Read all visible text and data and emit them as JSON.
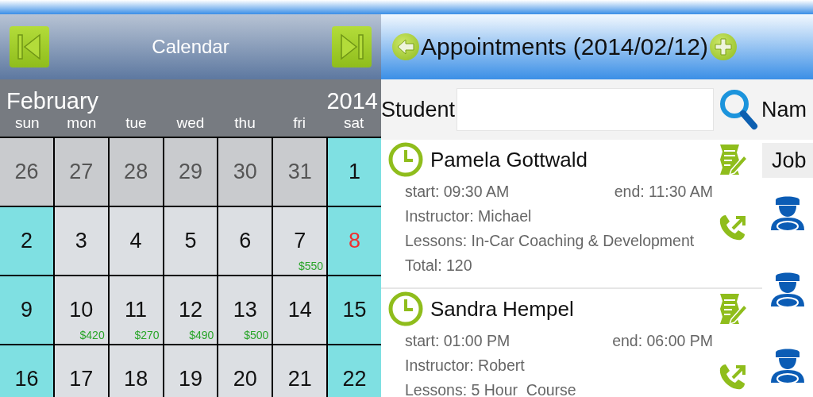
{
  "calendar": {
    "title": "Calendar",
    "month": "February",
    "year": "2014",
    "weekdays": [
      "sun",
      "mon",
      "tue",
      "wed",
      "thu",
      "fri",
      "sat"
    ],
    "weeks": [
      [
        {
          "day": "26",
          "kind": "other",
          "marked": false
        },
        {
          "day": "27",
          "kind": "other",
          "marked": false
        },
        {
          "day": "28",
          "kind": "other",
          "marked": false
        },
        {
          "day": "29",
          "kind": "other",
          "marked": false
        },
        {
          "day": "30",
          "kind": "other",
          "marked": false
        },
        {
          "day": "31",
          "kind": "other",
          "marked": false
        },
        {
          "day": "1",
          "kind": "weekend",
          "marked": false
        }
      ],
      [
        {
          "day": "2",
          "kind": "weekend",
          "marked": false
        },
        {
          "day": "3",
          "kind": "weekday",
          "marked": false
        },
        {
          "day": "4",
          "kind": "weekday",
          "marked": false
        },
        {
          "day": "5",
          "kind": "weekday",
          "marked": false
        },
        {
          "day": "6",
          "kind": "weekday",
          "marked": false
        },
        {
          "day": "7",
          "kind": "weekday",
          "marked": false,
          "amount": "$550"
        },
        {
          "day": "8",
          "kind": "weekend",
          "marked": true
        }
      ],
      [
        {
          "day": "9",
          "kind": "weekend",
          "marked": false
        },
        {
          "day": "10",
          "kind": "weekday",
          "marked": false,
          "amount": "$420"
        },
        {
          "day": "11",
          "kind": "weekday",
          "marked": false,
          "amount": "$270"
        },
        {
          "day": "12",
          "kind": "weekday",
          "marked": false,
          "amount": "$490"
        },
        {
          "day": "13",
          "kind": "weekday",
          "marked": false,
          "amount": "$500"
        },
        {
          "day": "14",
          "kind": "weekday",
          "marked": false
        },
        {
          "day": "15",
          "kind": "weekend",
          "marked": false
        }
      ],
      [
        {
          "day": "16",
          "kind": "weekend",
          "marked": false
        },
        {
          "day": "17",
          "kind": "weekday",
          "marked": false
        },
        {
          "day": "18",
          "kind": "weekday",
          "marked": false
        },
        {
          "day": "19",
          "kind": "weekday",
          "marked": false
        },
        {
          "day": "20",
          "kind": "weekday",
          "marked": false
        },
        {
          "day": "21",
          "kind": "weekday",
          "marked": false
        },
        {
          "day": "22",
          "kind": "weekend",
          "marked": false
        }
      ]
    ]
  },
  "appointments_panel": {
    "title": "Appointments (2014/02/12)",
    "search_label": "Student",
    "side_label": "Nam",
    "side_header": "Job",
    "appointments": [
      {
        "name": "Pamela Gottwald",
        "start": "start: 09:30 AM",
        "end": "end: 11:30 AM",
        "instructor": "Instructor: Michael",
        "lessons": "Lessons: In-Car Coaching & Development",
        "total": "Total: 120"
      },
      {
        "name": "Sandra Hempel",
        "start": "start: 01:00 PM",
        "end": "end: 06:00 PM",
        "instructor": "Instructor: Robert",
        "lessons": "Lessons: 5 Hour  Course"
      }
    ]
  }
}
